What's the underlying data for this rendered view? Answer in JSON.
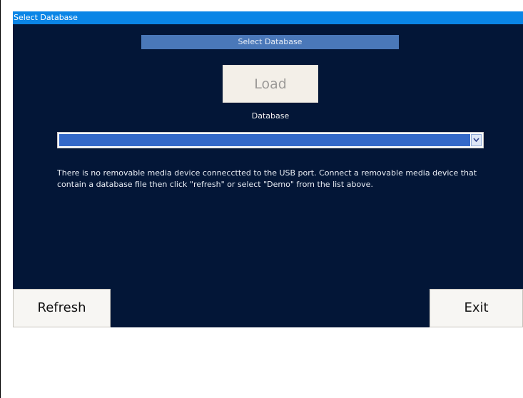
{
  "window": {
    "title": "Select Database"
  },
  "main": {
    "heading": "Select Database",
    "load_label": "Load",
    "database_label": "Database",
    "database_selected": "",
    "message": "There is no removable media device connecctted to the USB port. Connect a removable media device that contain a database file then click \"refresh\" or select \"Demo\" from the list above."
  },
  "footer": {
    "refresh_label": "Refresh",
    "exit_label": "Exit"
  },
  "icons": {
    "dropdown": "chevron-down-icon"
  },
  "colors": {
    "background": "#031637",
    "titlebar": "#0a85e6",
    "heading_bar": "#4a78b9",
    "select_field": "#3469c9"
  }
}
